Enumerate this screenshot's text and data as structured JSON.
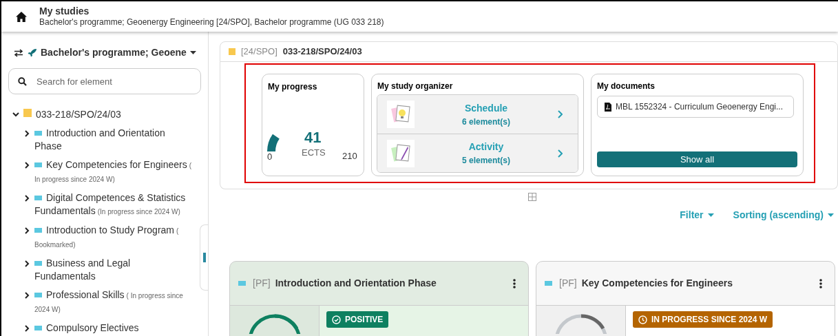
{
  "header": {
    "title": "My studies",
    "subtitle": "Bachelor's programme; Geoenergy Engineering [24/SPO], Bachelor programme (UG 033 218)"
  },
  "sidebar": {
    "program_selector": "Bachelor's programme; Geoene",
    "search": {
      "placeholder": "Search for element"
    },
    "tree": [
      {
        "label": "033-218/SPO/24/03",
        "color": "#f8c84e",
        "expanded": true,
        "children": [
          {
            "label": "Introduction and Orientation Phase",
            "color": "#5bc8e0",
            "expanded": false
          },
          {
            "label": "Key Competencies for Engineers",
            "note": "( In progress since 2024 W)",
            "color": "#5bc8e0",
            "expanded": false
          },
          {
            "label": "Digital Competences & Statistics Fundamentals",
            "note": "(In progress since 2024 W)",
            "color": "#5bc8e0",
            "expanded": false
          },
          {
            "label": "Introduction to Study Program",
            "note": "( Bookmarked)",
            "color": "#5bc8e0",
            "expanded": false
          },
          {
            "label": "Business and Legal Fundamentals",
            "color": "#5bc8e0",
            "expanded": false
          },
          {
            "label": "Professional Skills",
            "note": "( In progress since 2024 W)",
            "color": "#5bc8e0",
            "expanded": false
          },
          {
            "label": "Compulsory Electives",
            "color": "#5bc8e0",
            "expanded": false
          }
        ]
      }
    ]
  },
  "breadcrumb": {
    "code": "[24/SPO]",
    "title": "033-218/SPO/24/03"
  },
  "progress": {
    "title": "My progress",
    "value": "41",
    "unit": "ECTS",
    "min": "0",
    "max": "210",
    "level": 0.195
  },
  "organizer": {
    "title": "My study organizer",
    "items": [
      {
        "kind": "schedule",
        "title": "Schedule",
        "count": "6 element(s)"
      },
      {
        "kind": "activity",
        "title": "Activity",
        "count": "5 element(s)"
      }
    ]
  },
  "documents": {
    "title": "My documents",
    "items": [
      "MBL 1552324 - Curriculum Geoenergy Engi..."
    ],
    "button": "Show all"
  },
  "toolbar": {
    "filter": "Filter",
    "sorting": "Sorting (ascending)"
  },
  "cards": [
    {
      "code": "[PF]",
      "title": "Introduction and Orientation Phase",
      "status": {
        "kind": "positive",
        "label": "POSITIVE"
      }
    },
    {
      "code": "[PF]",
      "title": "Key Competencies for Engineers",
      "status": {
        "kind": "in_progress",
        "label": "IN PROGRESS SINCE 2024 W"
      }
    }
  ]
}
